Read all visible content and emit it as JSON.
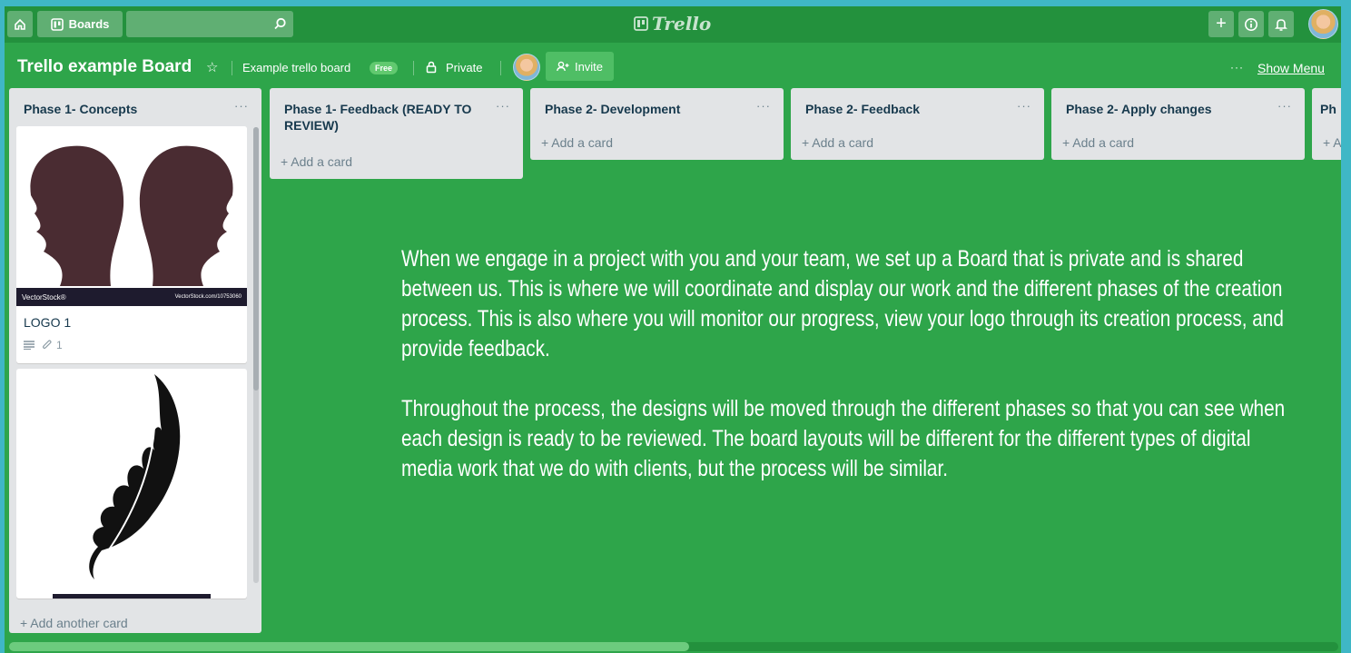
{
  "topbar": {
    "boards_label": "Boards",
    "logo_text": "Trello"
  },
  "board": {
    "title": "Trello example Board",
    "team": "Example trello board",
    "team_badge": "Free",
    "privacy": "Private",
    "invite": "Invite",
    "menu_dots": "···",
    "show_menu": "Show Menu"
  },
  "lists": [
    {
      "title": "Phase 1- Concepts",
      "cards": [
        {
          "title": "LOGO 1",
          "image_brand": "VectorStock®",
          "image_url_text": "VectorStock.com/10753060",
          "attachments": "1"
        },
        {
          "title": ""
        }
      ],
      "add": "+ Add another card"
    },
    {
      "title": "Phase 1- Feedback (READY TO REVIEW)",
      "add": "+ Add a card"
    },
    {
      "title": "Phase 2- Development",
      "add": "+ Add a card"
    },
    {
      "title": "Phase 2- Feedback",
      "add": "+ Add a card"
    },
    {
      "title": "Phase 2- Apply changes",
      "add": "+ Add a card"
    },
    {
      "title": "Ph",
      "add": "+ A"
    }
  ],
  "overlay": {
    "p1": "When we engage in a project with you and your team, we set up a Board that is private and is shared between us. This is where we will coordinate and display our work and the different phases of the creation process. This is also where you will monitor our progress, view your logo through its creation process, and provide feedback.",
    "p2": "Throughout the process, the designs will be moved through the different phases so that you can see when each design is ready to be reviewed. The board layouts will be different for the different types of digital media work that we do with clients, but the process will be similar."
  },
  "colors": {
    "board_bg": "#2ea54a",
    "frame_border": "#3fb7c6",
    "list_bg": "#e2e4e6"
  }
}
